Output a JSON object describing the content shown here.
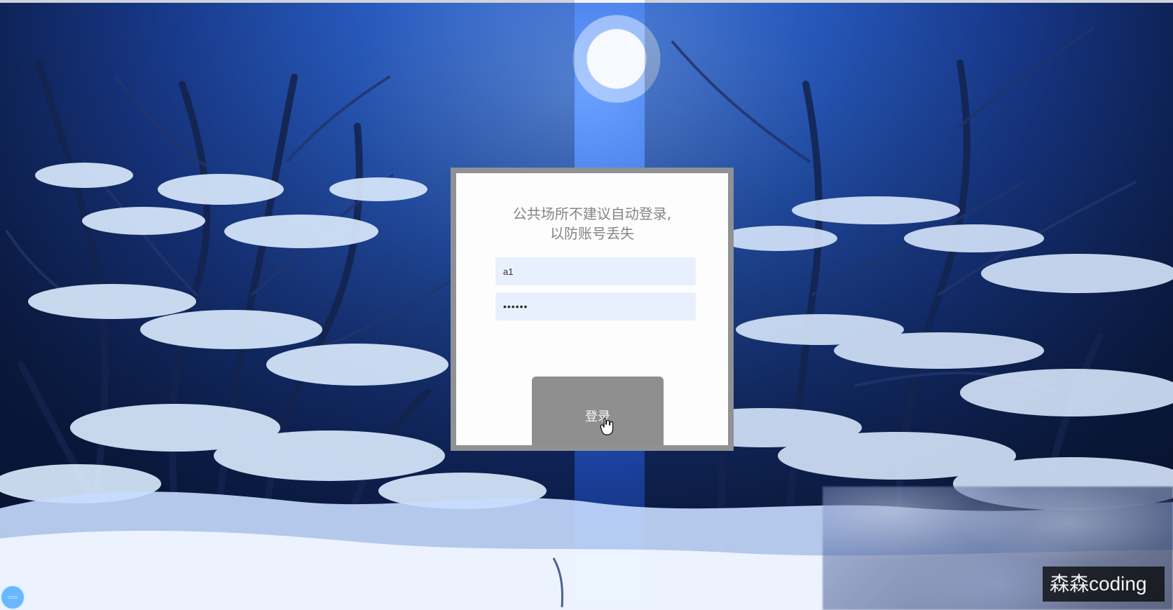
{
  "login": {
    "notice_line_1": "公共场所不建议自动登录,",
    "notice_line_2": "以防账号丢失",
    "username_value": "a1",
    "password_value": "••••••",
    "submit_label": "登录"
  },
  "watermark": {
    "text": "森森coding"
  },
  "colors": {
    "sky_blue": "#2d67d8",
    "panel_frame": "#8f9195",
    "input_fill": "#e8f0fe",
    "button_fill": "#8f8f8f"
  },
  "icons": {
    "cursor": "hand-cursor-icon",
    "bottom_left_badge": "circular-badge-icon"
  }
}
